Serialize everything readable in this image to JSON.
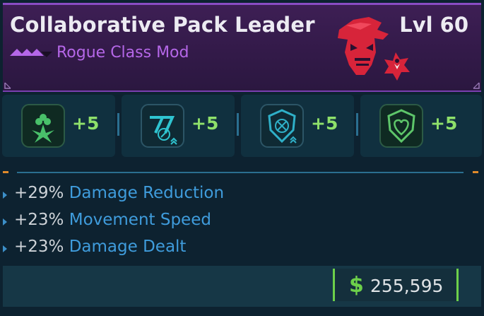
{
  "item": {
    "name": "Collaborative Pack Leader",
    "level_label": "Lvl 60",
    "type_label": "Rogue Class Mod",
    "rarity": "epic",
    "rarity_color": "#b567e8"
  },
  "skills": [
    {
      "icon": "clover-burst-skill-icon",
      "bonus": "+5",
      "color": "#49c06a"
    },
    {
      "icon": "slash-claw-skill-icon",
      "bonus": "+5",
      "color": "#2fc4d0"
    },
    {
      "icon": "shield-grid-skill-icon",
      "bonus": "+5",
      "color": "#2fb0c8"
    },
    {
      "icon": "heart-shield-skill-icon",
      "bonus": "+5",
      "color": "#5ec66a"
    }
  ],
  "stats": [
    {
      "value": "+29%",
      "name": "Damage Reduction"
    },
    {
      "value": "+23%",
      "name": "Movement Speed"
    },
    {
      "value": "+23%",
      "name": "Damage Dealt"
    }
  ],
  "price": {
    "currency_symbol": "$",
    "amount": "255,595",
    "accent_color": "#6dd04a"
  }
}
